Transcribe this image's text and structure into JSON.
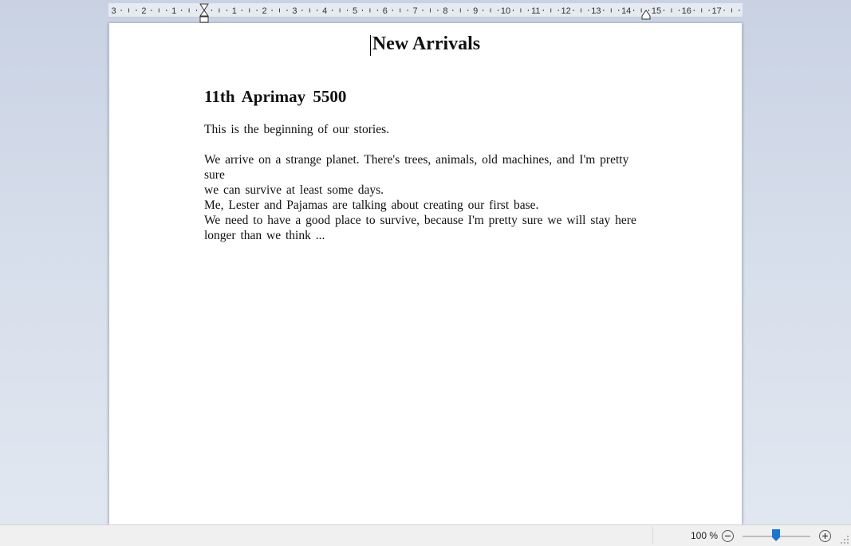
{
  "ruler": {
    "labels": [
      "3",
      "2",
      "1",
      "1",
      "2",
      "3",
      "4",
      "5",
      "6",
      "7",
      "8",
      "9",
      "10",
      "11",
      "12",
      "13",
      "14",
      "15",
      "16",
      "17"
    ]
  },
  "document": {
    "title": "New Arrivals",
    "heading": "11th Aprimay 5500",
    "paragraph1": "This is the beginning of our stories.",
    "paragraph2_lines": [
      "We arrive on a strange planet. There's trees, animals, old machines, and I'm pretty sure",
      "we can survive at least some days.",
      "Me, Lester and Pajamas are talking about creating our first base.",
      "We need to have a good place to survive, because I'm pretty sure we will stay here",
      "longer than we think ..."
    ]
  },
  "statusbar": {
    "zoom_label": "100 %",
    "zoom_percent": 100
  }
}
